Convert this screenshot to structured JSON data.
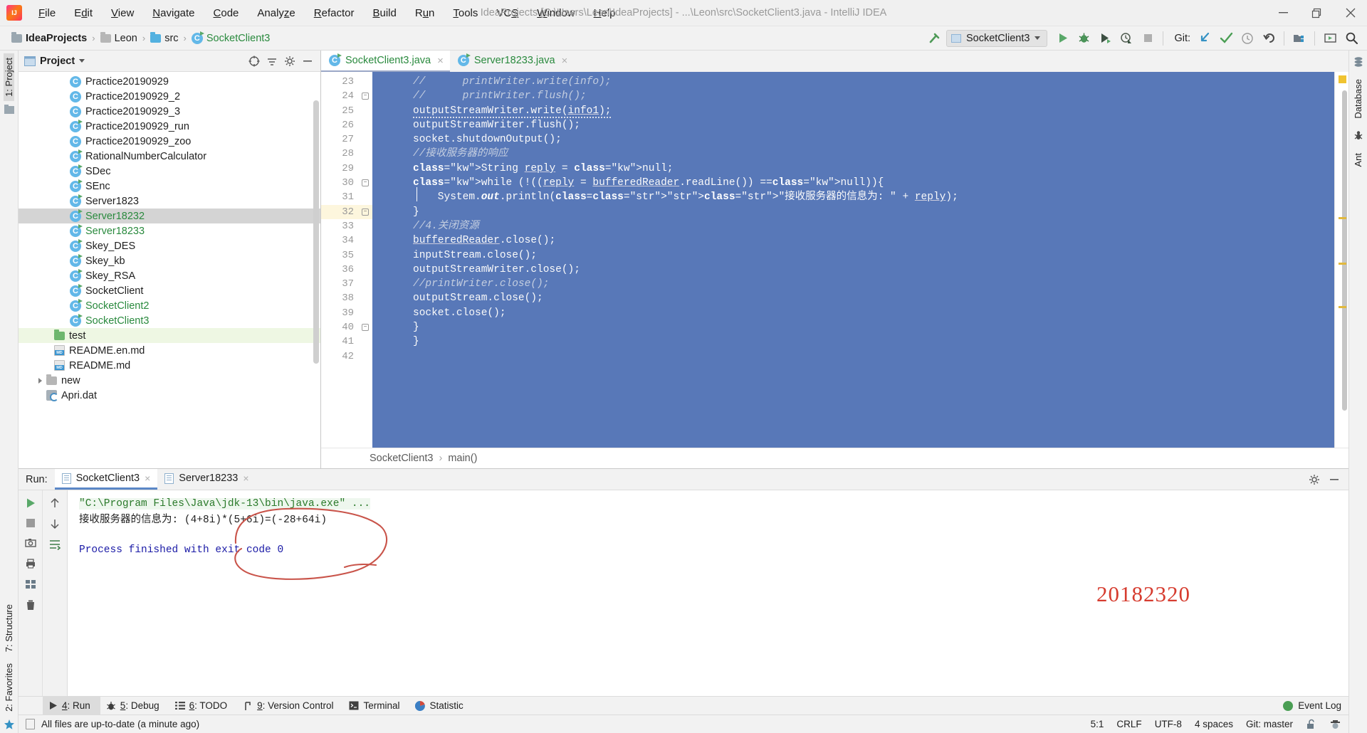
{
  "window": {
    "title": "IdeaProjects [C:\\Users\\Leon\\IdeaProjects] - ...\\Leon\\src\\SocketClient3.java - IntelliJ IDEA",
    "minimize_label": "minimize-icon",
    "restore_label": "restore-icon",
    "close_label": "close-icon"
  },
  "menubar": {
    "items": [
      {
        "label": "File",
        "mnemonic": "F"
      },
      {
        "label": "Edit",
        "mnemonic": "E"
      },
      {
        "label": "View",
        "mnemonic": "V"
      },
      {
        "label": "Navigate",
        "mnemonic": "N"
      },
      {
        "label": "Code",
        "mnemonic": "C"
      },
      {
        "label": "Analyze",
        "mnemonic": "z"
      },
      {
        "label": "Refactor",
        "mnemonic": "R"
      },
      {
        "label": "Build",
        "mnemonic": "B"
      },
      {
        "label": "Run",
        "mnemonic": "u"
      },
      {
        "label": "Tools",
        "mnemonic": "T"
      },
      {
        "label": "VCS",
        "mnemonic": "S"
      },
      {
        "label": "Window",
        "mnemonic": "W"
      },
      {
        "label": "Help",
        "mnemonic": "H"
      }
    ]
  },
  "navbar": {
    "breadcrumbs": [
      {
        "label": "IdeaProjects",
        "icon": "project-folder-icon",
        "bold": true
      },
      {
        "label": "Leon",
        "icon": "folder-icon",
        "bold": false
      },
      {
        "label": "src",
        "icon": "source-folder-icon",
        "bold": false
      },
      {
        "label": "SocketClient3",
        "icon": "java-class-icon",
        "bold": false
      }
    ],
    "separator": "›",
    "run_config": "SocketClient3",
    "git_label": "Git:",
    "icons": [
      "build-hammer-icon",
      "run-icon",
      "debug-icon",
      "run-coverage-icon",
      "profile-icon",
      "stop-icon",
      "git-update-icon",
      "git-commit-icon",
      "git-history-icon",
      "git-rollback-icon",
      "project-structure-icon",
      "select-in-icon",
      "search-icon"
    ]
  },
  "left_strips": {
    "top": {
      "label": "1: Project",
      "selected": true
    },
    "bottom": [
      {
        "label": "7: Structure"
      },
      {
        "label": "2: Favorites"
      }
    ]
  },
  "right_strips": [
    {
      "label": "Database",
      "icon": "database-icon"
    },
    {
      "label": "Ant",
      "icon": "ant-icon"
    }
  ],
  "project_panel": {
    "title": "Project",
    "head_icons": [
      "target-icon",
      "collapse-all-icon",
      "settings-gear-icon",
      "hide-icon"
    ],
    "tree": [
      {
        "label": "Practice20190929",
        "icon": "java-class-icon",
        "runnable": false,
        "vcs_modified": false,
        "indent": 3
      },
      {
        "label": "Practice20190929_2",
        "icon": "java-class-icon",
        "runnable": false,
        "vcs_modified": false,
        "indent": 3
      },
      {
        "label": "Practice20190929_3",
        "icon": "java-class-icon",
        "runnable": false,
        "vcs_modified": false,
        "indent": 3
      },
      {
        "label": "Practice20190929_run",
        "icon": "java-class-icon",
        "runnable": true,
        "vcs_modified": false,
        "indent": 3
      },
      {
        "label": "Practice20190929_zoo",
        "icon": "java-class-icon",
        "runnable": false,
        "vcs_modified": false,
        "indent": 3
      },
      {
        "label": "RationalNumberCalculator",
        "icon": "java-class-icon",
        "runnable": true,
        "vcs_modified": false,
        "indent": 3
      },
      {
        "label": "SDec",
        "icon": "java-class-icon",
        "runnable": true,
        "vcs_modified": false,
        "indent": 3
      },
      {
        "label": "SEnc",
        "icon": "java-class-icon",
        "runnable": true,
        "vcs_modified": false,
        "indent": 3
      },
      {
        "label": "Server1823",
        "icon": "java-class-icon",
        "runnable": true,
        "vcs_modified": false,
        "indent": 3
      },
      {
        "label": "Server18232",
        "icon": "java-class-icon",
        "runnable": true,
        "vcs_modified": true,
        "selected": true,
        "indent": 3
      },
      {
        "label": "Server18233",
        "icon": "java-class-icon",
        "runnable": true,
        "vcs_modified": true,
        "indent": 3
      },
      {
        "label": "Skey_DES",
        "icon": "java-class-icon",
        "runnable": true,
        "vcs_modified": false,
        "indent": 3
      },
      {
        "label": "Skey_kb",
        "icon": "java-class-icon",
        "runnable": true,
        "vcs_modified": false,
        "indent": 3
      },
      {
        "label": "Skey_RSA",
        "icon": "java-class-icon",
        "runnable": true,
        "vcs_modified": false,
        "indent": 3
      },
      {
        "label": "SocketClient",
        "icon": "java-class-icon",
        "runnable": true,
        "vcs_modified": false,
        "indent": 3
      },
      {
        "label": "SocketClient2",
        "icon": "java-class-icon",
        "runnable": true,
        "vcs_modified": true,
        "indent": 3
      },
      {
        "label": "SocketClient3",
        "icon": "java-class-icon",
        "runnable": true,
        "vcs_modified": true,
        "indent": 3
      },
      {
        "label": "test",
        "icon": "green-folder-icon",
        "green_row": true,
        "indent": 2
      },
      {
        "label": "README.en.md",
        "icon": "markdown-icon",
        "indent": 2
      },
      {
        "label": "README.md",
        "icon": "markdown-icon",
        "indent": 2
      },
      {
        "label": "new",
        "icon": "folder-icon",
        "expandable": true,
        "indent": 1
      },
      {
        "label": "Apri.dat",
        "icon": "data-file-icon",
        "indent": 1
      }
    ]
  },
  "editor": {
    "tabs": [
      {
        "label": "SocketClient3.java",
        "active": true,
        "icon": "java-class-icon",
        "close": "×"
      },
      {
        "label": "Server18233.java",
        "active": false,
        "icon": "java-class-icon",
        "close": "×"
      }
    ],
    "first_line": 23,
    "line_numbers": [
      23,
      24,
      25,
      26,
      27,
      28,
      29,
      30,
      31,
      32,
      33,
      34,
      35,
      36,
      37,
      38,
      39,
      40,
      41,
      42
    ],
    "current_line": 32,
    "lines": [
      {
        "n": 23,
        "text": "//      printWriter.write(info);",
        "style": "comment"
      },
      {
        "n": 24,
        "text": "//      printWriter.flush();",
        "style": "comment",
        "fold": true
      },
      {
        "n": 25,
        "text": "outputStreamWriter.write(info1);",
        "style": "code-warn"
      },
      {
        "n": 26,
        "text": "outputStreamWriter.flush();",
        "style": "code"
      },
      {
        "n": 27,
        "text": "socket.shutdownOutput();",
        "style": "code"
      },
      {
        "n": 28,
        "text": "//接收服务器的响应",
        "style": "comment"
      },
      {
        "n": 29,
        "text": "String reply = null;",
        "style": "code"
      },
      {
        "n": 30,
        "text": "while (!((reply = bufferedReader.readLine()) ==null)){",
        "style": "code",
        "fold": true
      },
      {
        "n": 31,
        "text": "    System.out.println(\"接收服务器的信息为: \" + reply);",
        "style": "code"
      },
      {
        "n": 32,
        "text": "}",
        "style": "code",
        "fold": true
      },
      {
        "n": 33,
        "text": "//4.关闭资源",
        "style": "comment"
      },
      {
        "n": 34,
        "text": "bufferedReader.close();",
        "style": "code"
      },
      {
        "n": 35,
        "text": "inputStream.close();",
        "style": "code"
      },
      {
        "n": 36,
        "text": "outputStreamWriter.close();",
        "style": "code"
      },
      {
        "n": 37,
        "text": "//printWriter.close();",
        "style": "comment"
      },
      {
        "n": 38,
        "text": "outputStream.close();",
        "style": "code"
      },
      {
        "n": 39,
        "text": "socket.close();",
        "style": "code"
      },
      {
        "n": 40,
        "text": "}",
        "style": "code",
        "fold": true
      },
      {
        "n": 41,
        "text": "}",
        "style": "code"
      },
      {
        "n": 42,
        "text": "",
        "style": "code"
      }
    ],
    "breadcrumb": {
      "class": "SocketClient3",
      "method": "main()",
      "sep": "›"
    }
  },
  "run_panel": {
    "label": "Run:",
    "tabs": [
      {
        "label": "SocketClient3",
        "active": true,
        "close": "×"
      },
      {
        "label": "Server18233",
        "active": false,
        "close": "×"
      }
    ],
    "head_icons": [
      "settings-gear-icon",
      "hide-panel-icon"
    ],
    "side_icons_left": [
      "rerun-icon",
      "stop-icon",
      "screenshot-icon",
      "print-icon",
      "grid-icon",
      "trash-icon"
    ],
    "side_icons_right": [
      "scroll-up-icon",
      "scroll-down-icon",
      "soft-wrap-icon"
    ],
    "console": {
      "command": "\"C:\\Program Files\\Java\\jdk-13\\bin\\java.exe\" ...",
      "output": "接收服务器的信息为: (4+8i)*(5+6i)=(-28+64i)",
      "finished": "Process finished with exit code 0"
    },
    "annotation": {
      "student_id": "20182320",
      "color": "#d63c2f",
      "shape": "hand-drawn-ellipse"
    }
  },
  "tool_windows": {
    "items": [
      {
        "label": "4: Run",
        "mnemonic": "4",
        "icon": "run-icon",
        "active": true
      },
      {
        "label": "5: Debug",
        "mnemonic": "5",
        "icon": "debug-icon",
        "active": false
      },
      {
        "label": "6: TODO",
        "mnemonic": "6",
        "icon": "todo-icon",
        "active": false
      },
      {
        "label": "9: Version Control",
        "mnemonic": "9",
        "icon": "branch-icon",
        "active": false
      },
      {
        "label": "Terminal",
        "mnemonic": "",
        "icon": "terminal-icon",
        "active": false
      },
      {
        "label": "Statistic",
        "mnemonic": "",
        "icon": "statistic-icon",
        "active": false
      }
    ],
    "event_log": "Event Log"
  },
  "statusbar": {
    "message": "All files are up-to-date (a minute ago)",
    "caret": "5:1",
    "line_sep": "CRLF",
    "encoding": "UTF-8",
    "indent": "4 spaces",
    "git_branch": "Git: master",
    "icons": [
      "lock-open-icon",
      "hector-icon"
    ]
  },
  "colors": {
    "selection_blue": "#5878b8",
    "accent_green": "#2a8a3e",
    "annotation_red": "#d63c2f",
    "panel_bg": "#f2f2f2"
  }
}
